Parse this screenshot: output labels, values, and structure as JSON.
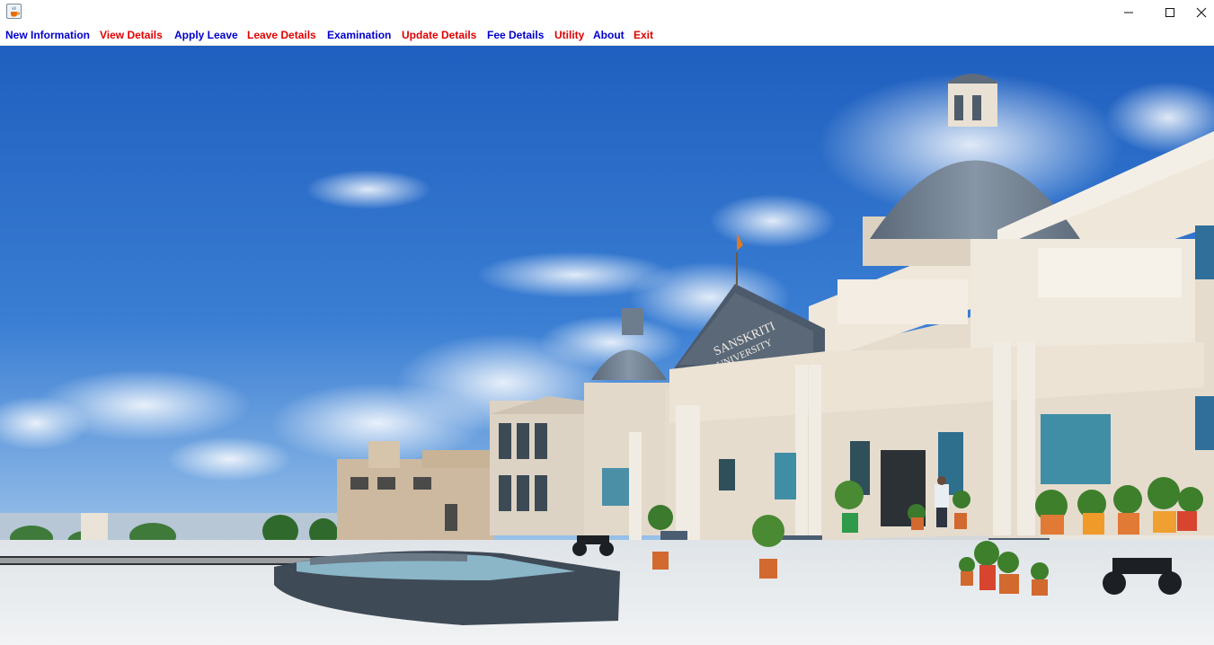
{
  "window": {
    "icon": "java-coffee-icon",
    "controls": [
      "minimize-icon",
      "maximize-icon",
      "close-icon"
    ]
  },
  "menu": {
    "items": [
      {
        "label": "New Information",
        "color": "#0000cc"
      },
      {
        "label": "View Details",
        "color": "#e00000"
      },
      {
        "label": "Apply Leave",
        "color": "#0000cc"
      },
      {
        "label": "Leave Details",
        "color": "#e00000"
      },
      {
        "label": "Examination",
        "color": "#0000cc"
      },
      {
        "label": "Update Details",
        "color": "#e00000"
      },
      {
        "label": "Fee Details",
        "color": "#0000cc"
      },
      {
        "label": "Utility",
        "color": "#e00000"
      },
      {
        "label": "About",
        "color": "#0000cc"
      },
      {
        "label": "Exit",
        "color": "#e00000"
      }
    ]
  },
  "background": {
    "sign_line1": "SANSKRITI",
    "sign_line2": "UNIVERSITY",
    "sky_color": "#2f6fc8",
    "building_color": "#e6dccd"
  }
}
